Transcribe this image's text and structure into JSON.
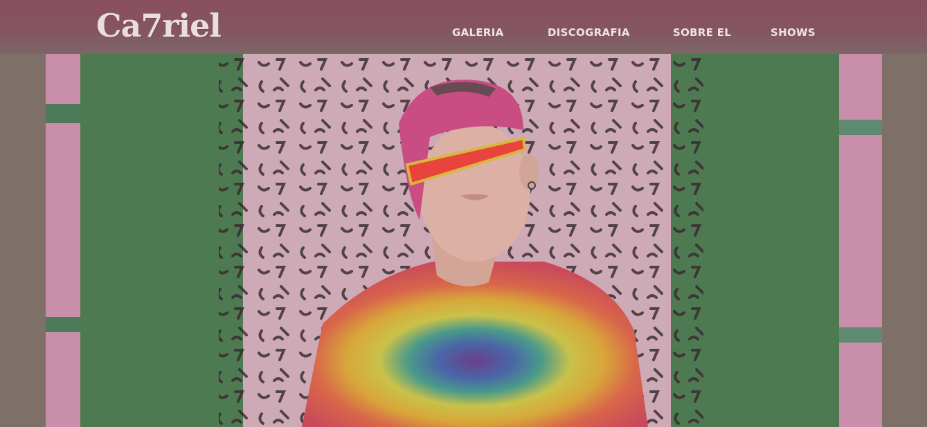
{
  "header": {
    "logo": "Ca7riel",
    "nav": [
      {
        "label": "GALERIA"
      },
      {
        "label": "DISCOGRAFIA"
      },
      {
        "label": "SOBRE EL"
      },
      {
        "label": "SHOWS"
      }
    ]
  },
  "hero": {
    "image": "artist-photo",
    "colors": {
      "overlay": "#7e6f69",
      "green_wall": "#4e7a52",
      "pink_wall": "#c98ea9",
      "cap": "#c94d82",
      "sunglasses": "#e8443d"
    }
  }
}
